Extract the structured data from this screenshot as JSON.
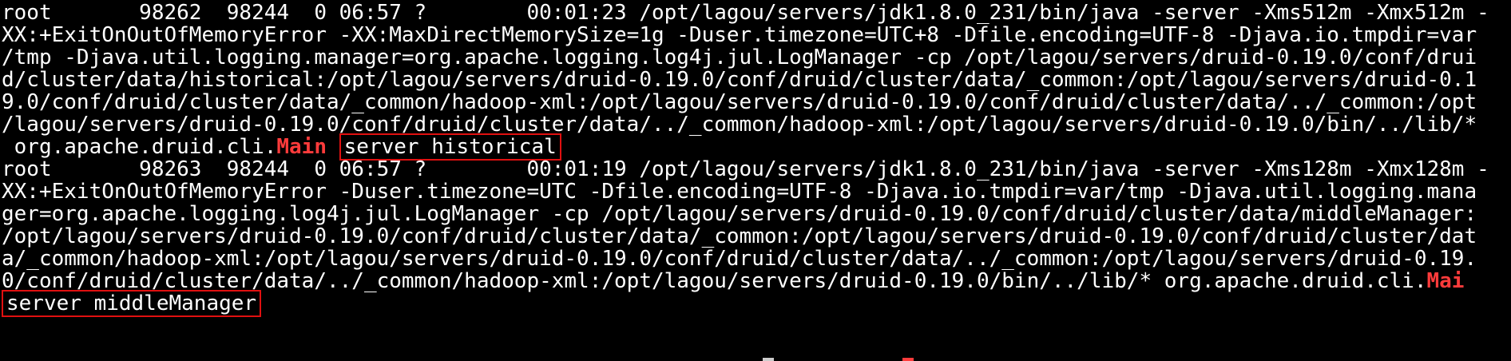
{
  "process1": {
    "line1": "root       98262  98244  0 06:57 ?        00:01:23 /opt/lagou/servers/jdk1.8.0_231/bin/java -server -Xms512m -Xmx512m -",
    "line2": "XX:+ExitOnOutOfMemoryError -XX:MaxDirectMemorySize=1g -Duser.timezone=UTC+8 -Dfile.encoding=UTF-8 -Djava.io.tmpdir=var",
    "line3": "/tmp -Djava.util.logging.manager=org.apache.logging.log4j.jul.LogManager -cp /opt/lagou/servers/druid-0.19.0/conf/drui",
    "line4": "d/cluster/data/historical:/opt/lagou/servers/druid-0.19.0/conf/druid/cluster/data/_common:/opt/lagou/servers/druid-0.1",
    "line5": "9.0/conf/druid/cluster/data/_common/hadoop-xml:/opt/lagou/servers/druid-0.19.0/conf/druid/cluster/data/../_common:/opt",
    "line6": "/lagou/servers/druid-0.19.0/conf/druid/cluster/data/../_common/hadoop-xml:/opt/lagou/servers/druid-0.19.0/bin/../lib/*",
    "line7_prefix": " org.apache.druid.cli.",
    "line7_main": "Main",
    "line7_args": "server historical"
  },
  "process2": {
    "line1": "root       98263  98244  0 06:57 ?        00:01:19 /opt/lagou/servers/jdk1.8.0_231/bin/java -server -Xms128m -Xmx128m -",
    "line2": "XX:+ExitOnOutOfMemoryError -Duser.timezone=UTC -Dfile.encoding=UTF-8 -Djava.io.tmpdir=var/tmp -Djava.util.logging.mana",
    "line3": "ger=org.apache.logging.log4j.jul.LogManager -cp /opt/lagou/servers/druid-0.19.0/conf/druid/cluster/data/middleManager:",
    "line4": "/opt/lagou/servers/druid-0.19.0/conf/druid/cluster/data/_common:/opt/lagou/servers/druid-0.19.0/conf/druid/cluster/dat",
    "line5": "a/_common/hadoop-xml:/opt/lagou/servers/druid-0.19.0/conf/druid/cluster/data/../_common:/opt/lagou/servers/druid-0.19.",
    "line6_prefix": "0/conf/druid/cluster/data/../_common/hadoop-xml:/opt/lagou/servers/druid-0.19.0/bin/../lib/* org.apache.druid.cli.",
    "line6_main": "Mai",
    "line7_args": "server middleManager"
  },
  "colors": {
    "background": "#000000",
    "text": "#ffffff",
    "highlight": "#ff3b3b",
    "box_border": "#e01010"
  }
}
